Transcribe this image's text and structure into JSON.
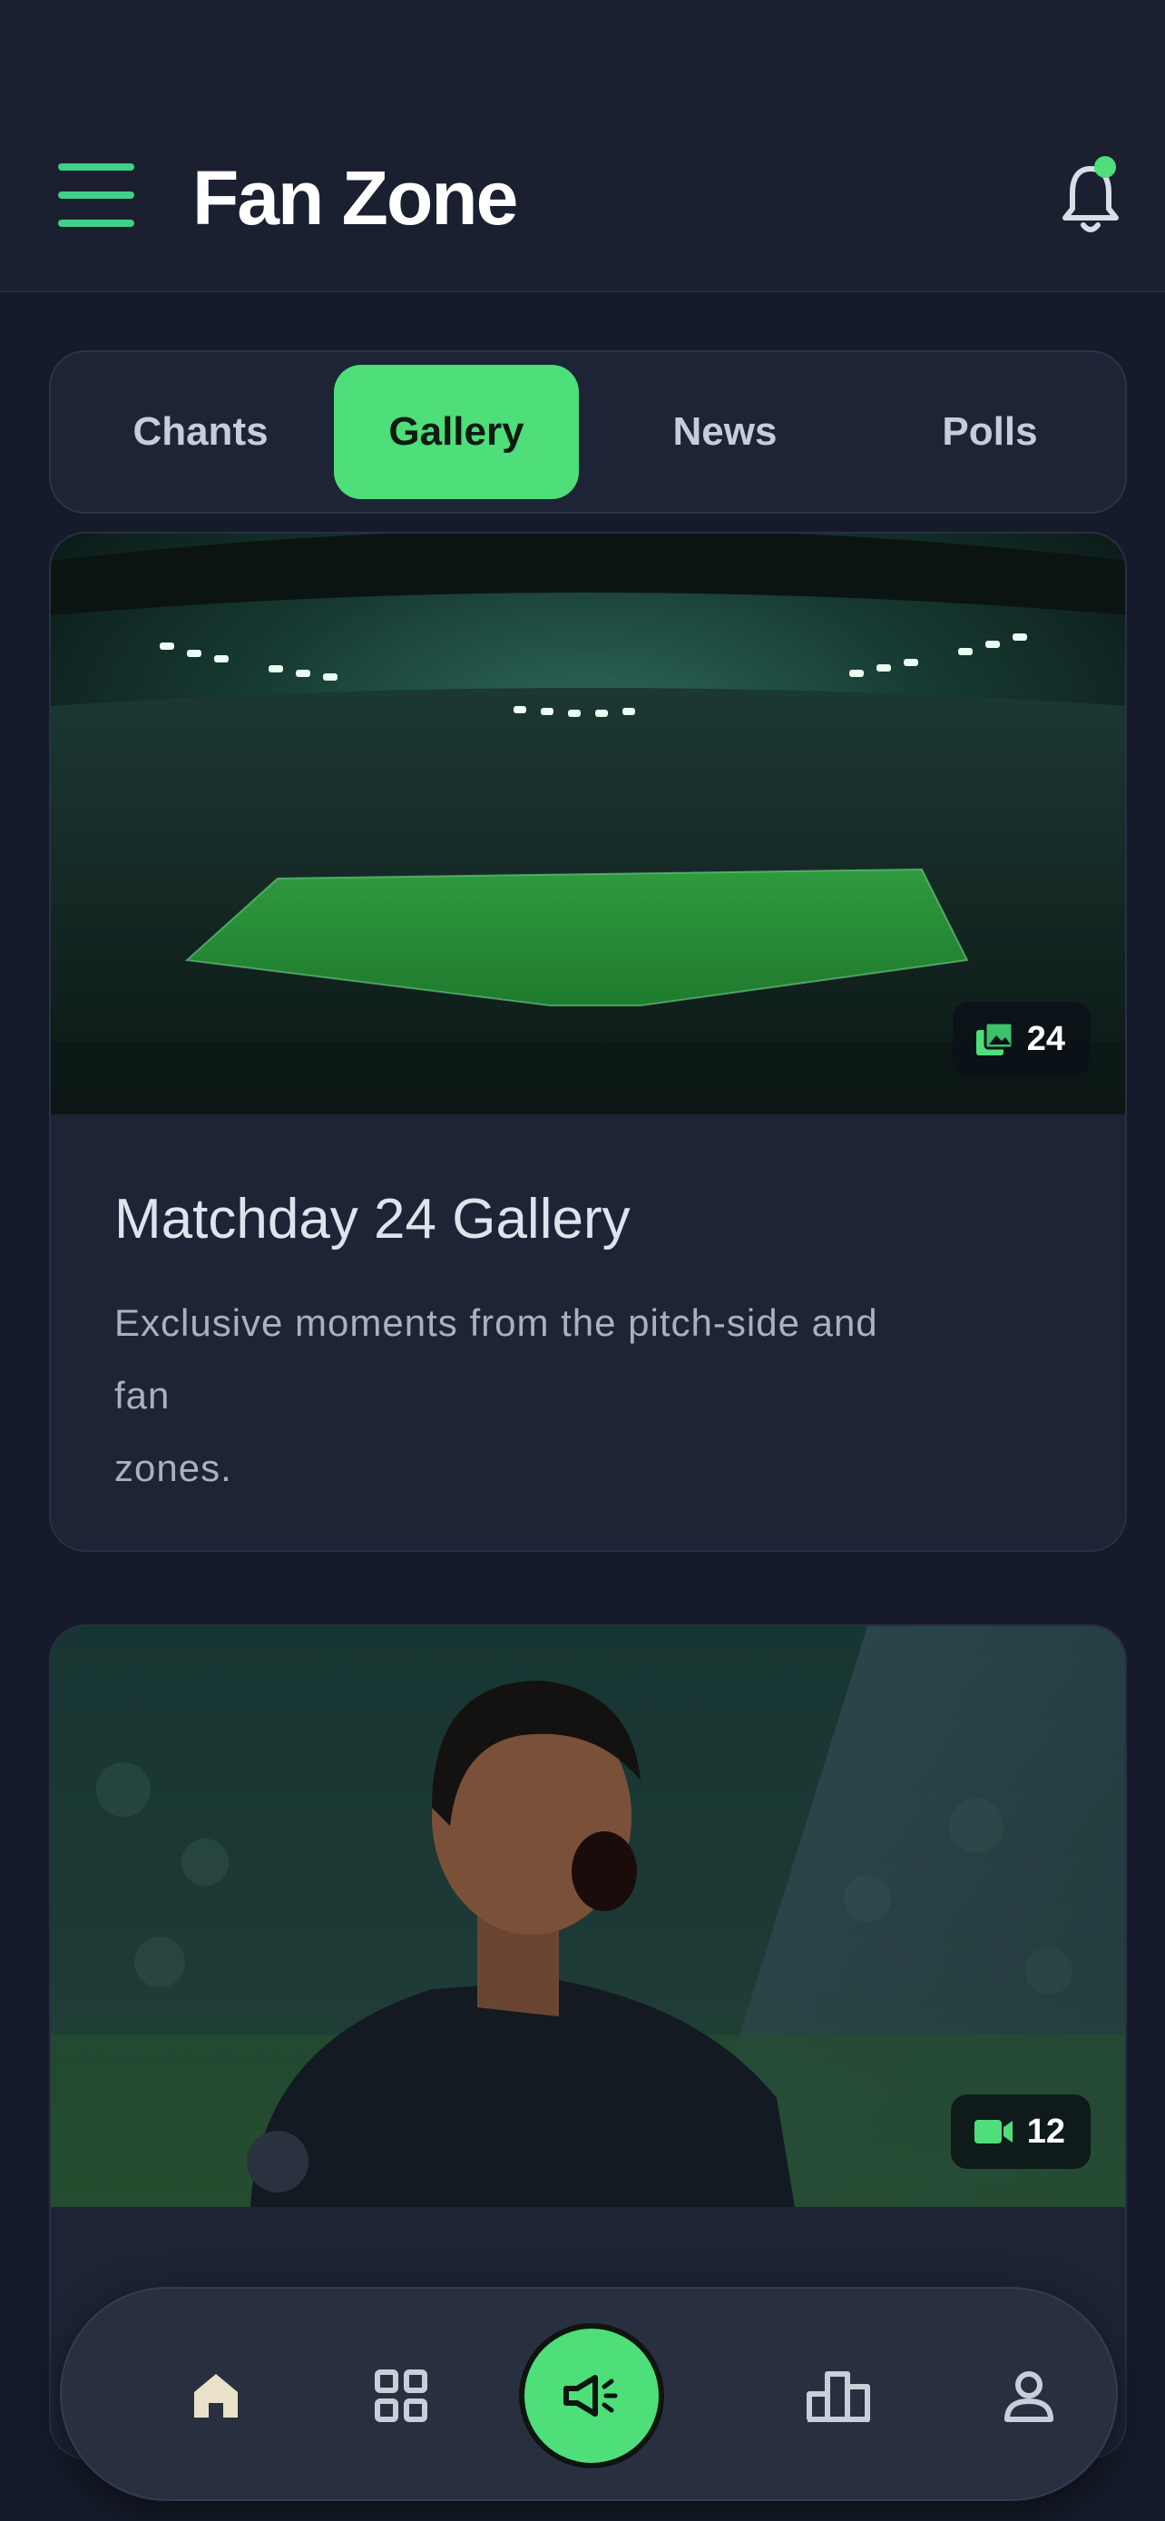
{
  "header": {
    "title": "Fan Zone"
  },
  "tabs": [
    {
      "label": "Chants",
      "active": false
    },
    {
      "label": "Gallery",
      "active": true
    },
    {
      "label": "News",
      "active": false
    },
    {
      "label": "Polls",
      "active": false
    }
  ],
  "cards": [
    {
      "badge_icon": "photo-stack-icon",
      "badge_count": "24",
      "title": "Matchday 24 Gallery",
      "description_lines": [
        "Exclusive moments from the pitch-side and",
        "fan",
        "zones."
      ]
    },
    {
      "badge_icon": "video-camera-icon",
      "badge_count": "12"
    }
  ],
  "bottom_nav": [
    "home-icon",
    "grid-icon",
    "megaphone-icon",
    "leaderboard-icon",
    "profile-icon"
  ],
  "colors": {
    "accent": "#4ede7a",
    "background": "#151b2a",
    "surface": "#1d2435"
  }
}
